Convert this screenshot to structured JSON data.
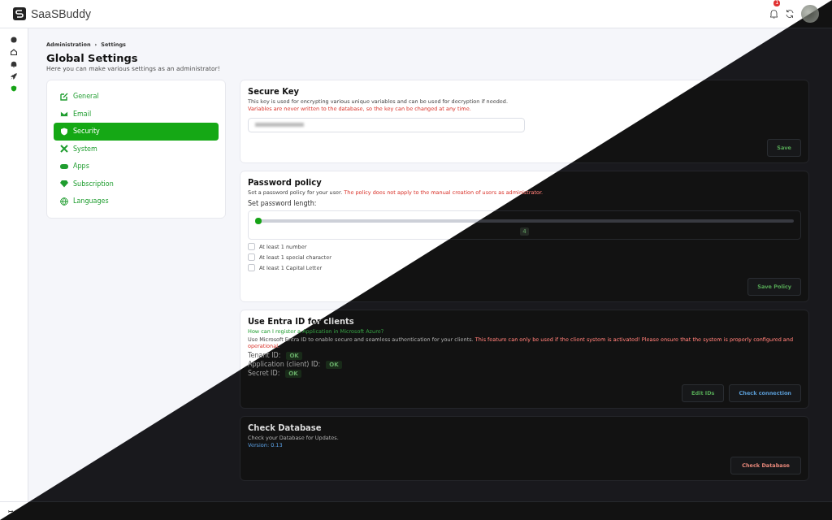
{
  "app": {
    "name": "SaaSBuddy",
    "notification_count": "1"
  },
  "rail": [
    {
      "kind": "palette",
      "selected": false
    },
    {
      "kind": "home",
      "selected": false
    },
    {
      "kind": "bell",
      "selected": false
    },
    {
      "kind": "rocket",
      "selected": false
    },
    {
      "kind": "shield",
      "selected": true
    }
  ],
  "breadcrumb": [
    "Administration",
    "›",
    "Settings"
  ],
  "page": {
    "title": "Global Settings",
    "subtitle": "Here you can make various settings as an administrator!"
  },
  "settings_nav": [
    {
      "label": "General",
      "kind": "edit",
      "selected": false
    },
    {
      "label": "Email",
      "kind": "mail",
      "selected": false
    },
    {
      "label": "Security",
      "kind": "shield",
      "selected": true
    },
    {
      "label": "System",
      "kind": "tools",
      "selected": false
    },
    {
      "label": "Apps",
      "kind": "toggle",
      "selected": false
    },
    {
      "label": "Subscription",
      "kind": "gem",
      "selected": false
    },
    {
      "label": "Languages",
      "kind": "globe",
      "selected": false
    }
  ],
  "secure_key": {
    "title": "Secure Key",
    "description": "This key is used for encrypting various unique variables and can be used for decryption if needed.",
    "warning": "Variables are never written to the database, so the key can be changed at any time.",
    "button": "Save"
  },
  "password_policy": {
    "title": "Password policy",
    "description": "Set a password policy for your user.",
    "warning": "The policy does not apply to the manual creation of users as administrator.",
    "length_label": "Set password length:",
    "slider": {
      "level": 0,
      "reading": "4"
    },
    "options": [
      {
        "kind": "checkbox",
        "label": "At least 1 number",
        "checked": false
      },
      {
        "kind": "checkbox",
        "label": "At least 1 special character",
        "checked": false
      },
      {
        "kind": "checkbox",
        "label": "At least 1 Capital Letter",
        "checked": false
      }
    ],
    "button": "Save Policy"
  },
  "entra": {
    "title": "Use Entra ID for clients",
    "help_link": "How can I register a Application in Microsoft Azure?",
    "description": "Use Microsoft Entra ID to enable secure and seamless authentication for your clients.",
    "warning": "This feature can only be used if the client system is activated! Please ensure that the system is properly configured and operational.",
    "ids": [
      {
        "label": "Tenant ID:",
        "status": "OK"
      },
      {
        "label": "Application (client) ID:",
        "status": "OK"
      },
      {
        "label": "Secret ID:",
        "status": "OK"
      }
    ],
    "buttons": [
      {
        "label": "Edit IDs",
        "kind": "green"
      },
      {
        "label": "Check connection",
        "kind": "blue"
      }
    ]
  },
  "database": {
    "title": "Check Database",
    "description": "Check your Database for Updates.",
    "version": "Version: 0.13",
    "button": "Check Database"
  },
  "footer": {
    "expand_icon": "↦"
  }
}
